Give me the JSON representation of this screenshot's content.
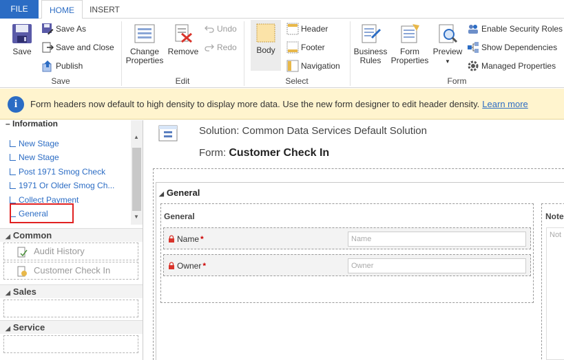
{
  "tabs": {
    "file": "FILE",
    "home": "HOME",
    "insert": "INSERT"
  },
  "ribbon": {
    "save_group": {
      "save": "Save",
      "save_as": "Save As",
      "save_and_close": "Save and Close",
      "publish": "Publish",
      "label": "Save"
    },
    "edit_group": {
      "change_properties_1": "Change",
      "change_properties_2": "Properties",
      "remove": "Remove",
      "undo": "Undo",
      "redo": "Redo",
      "label": "Edit"
    },
    "select_group": {
      "body": "Body",
      "header": "Header",
      "footer": "Footer",
      "navigation": "Navigation",
      "label": "Select"
    },
    "form_group": {
      "business_rules_1": "Business",
      "business_rules_2": "Rules",
      "form_properties_1": "Form",
      "form_properties_2": "Properties",
      "preview": "Preview",
      "enable_security_roles": "Enable Security Roles",
      "show_dependencies": "Show Dependencies",
      "managed_properties": "Managed Properties",
      "label": "Form"
    }
  },
  "infobar": {
    "message": "Form headers now default to high density to display more data. Use the new form designer to edit header density.",
    "link": "Learn more"
  },
  "leftnav": {
    "tree_header": "Information",
    "tree_items": [
      "New Stage",
      "New Stage",
      "Post 1971 Smog Check",
      "1971 Or Older Smog Ch...",
      "Collect Payment",
      "General"
    ],
    "sections": {
      "common": "Common",
      "sales": "Sales",
      "service": "Service"
    },
    "common_items": {
      "audit_history": "Audit History",
      "customer_check_in": "Customer Check In"
    }
  },
  "main": {
    "solution_label": "Solution: Common Data Services Default Solution",
    "form_label": "Form: ",
    "form_name": "Customer Check In",
    "tab_title": "General",
    "section_title": "General",
    "fields": [
      {
        "label": "Name",
        "placeholder": "Name"
      },
      {
        "label": "Owner",
        "placeholder": "Owner"
      }
    ],
    "notes_title": "Note",
    "notes_placeholder": "Not"
  },
  "colors": {
    "accent": "#2b6cc4",
    "infobar_bg": "#fff4ce",
    "highlight": "#e02020",
    "required": "#cc0000"
  }
}
